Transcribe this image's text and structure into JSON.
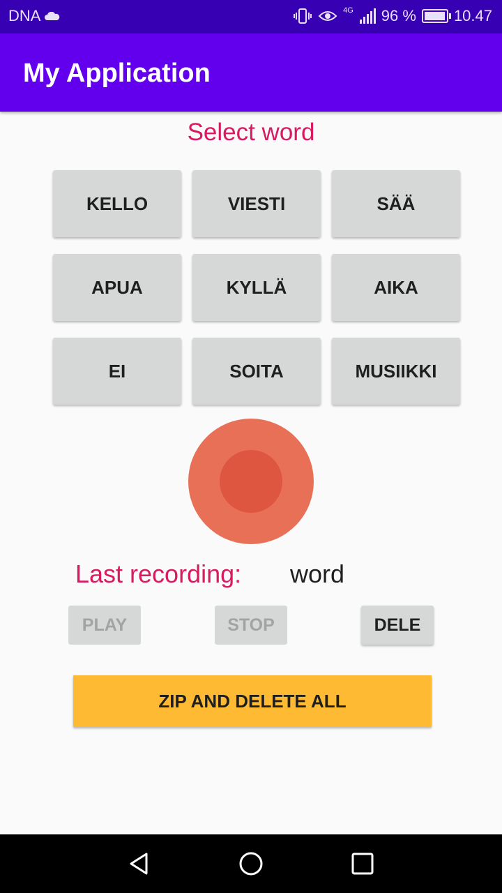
{
  "status_bar": {
    "carrier": "DNA",
    "network": "4G",
    "battery": "96 %",
    "battery_level": 0.96,
    "time": "10.47"
  },
  "app_bar": {
    "title": "My Application"
  },
  "select_word": {
    "label": "Select word",
    "words": [
      "KELLO",
      "VIESTI",
      "SÄÄ",
      "APUA",
      "KYLLÄ",
      "AIKA",
      "EI",
      "SOITA",
      "MUSIIKKI"
    ]
  },
  "recording": {
    "last_label": "Last recording:",
    "last_value": "word"
  },
  "controls": {
    "play_label": "PLAY",
    "stop_label": "STOP",
    "delete_label": "DELE",
    "zip_label": "ZIP AND DELETE ALL"
  },
  "colors": {
    "status_bar": "#3700b3",
    "app_bar": "#6200ee",
    "accent_text": "#d81b60",
    "record_outer": "#e87057",
    "record_inner": "#de5540",
    "zip_button": "#fdba32"
  },
  "icons": {
    "status": [
      "cloud-icon",
      "vibrate-icon",
      "eye-icon",
      "signal-icon",
      "battery-icon"
    ],
    "nav": [
      "back-icon",
      "home-icon",
      "recents-icon"
    ],
    "record": "record-icon"
  }
}
